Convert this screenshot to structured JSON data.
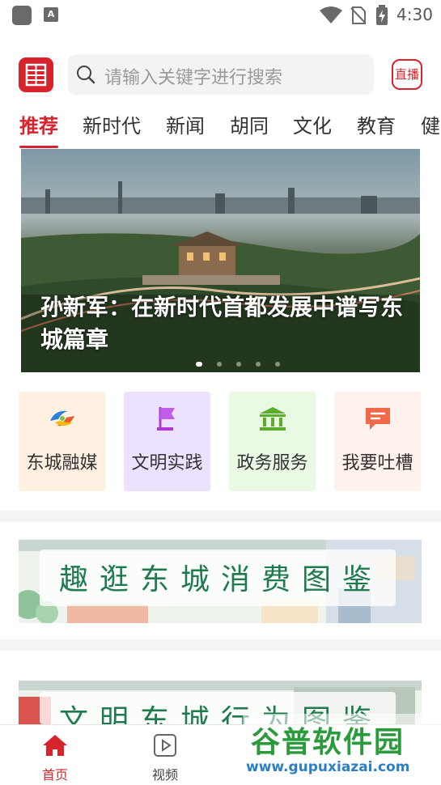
{
  "status_bar": {
    "time": "4:30",
    "notification_letter": "A"
  },
  "header": {
    "search_placeholder": "请输入关键字进行搜索",
    "live_label": "直播"
  },
  "tabs": [
    "推荐",
    "新时代",
    "新闻",
    "胡同",
    "文化",
    "教育",
    "健"
  ],
  "active_tab": "推荐",
  "banner": {
    "title": "孙新军：在新时代首都发展中谱写东城篇章",
    "slide_count": 5,
    "active_slide": 1
  },
  "services": [
    {
      "label": "东城融媒",
      "icon": "swirl-logo-icon",
      "bg": "#fff1e2"
    },
    {
      "label": "文明实践",
      "icon": "flag-icon",
      "bg": "#ece2ff"
    },
    {
      "label": "政务服务",
      "icon": "government-building-icon",
      "bg": "#eaf9e4"
    },
    {
      "label": "我要吐槽",
      "icon": "chat-bubble-icon",
      "bg": "#fff1ec"
    }
  ],
  "features": [
    {
      "title": "趣逛东城消费图鉴"
    },
    {
      "title": "文明东城行为图鉴"
    }
  ],
  "bottom_nav": [
    {
      "label": "首页",
      "icon": "home-icon",
      "active": true
    },
    {
      "label": "视频",
      "icon": "video-icon",
      "active": false
    }
  ],
  "watermark": {
    "brand": "谷普软件园",
    "url": "www.gupuxiazai.com"
  },
  "colors": {
    "accent": "#d9232c",
    "feature_text": "#1f7a4d"
  }
}
